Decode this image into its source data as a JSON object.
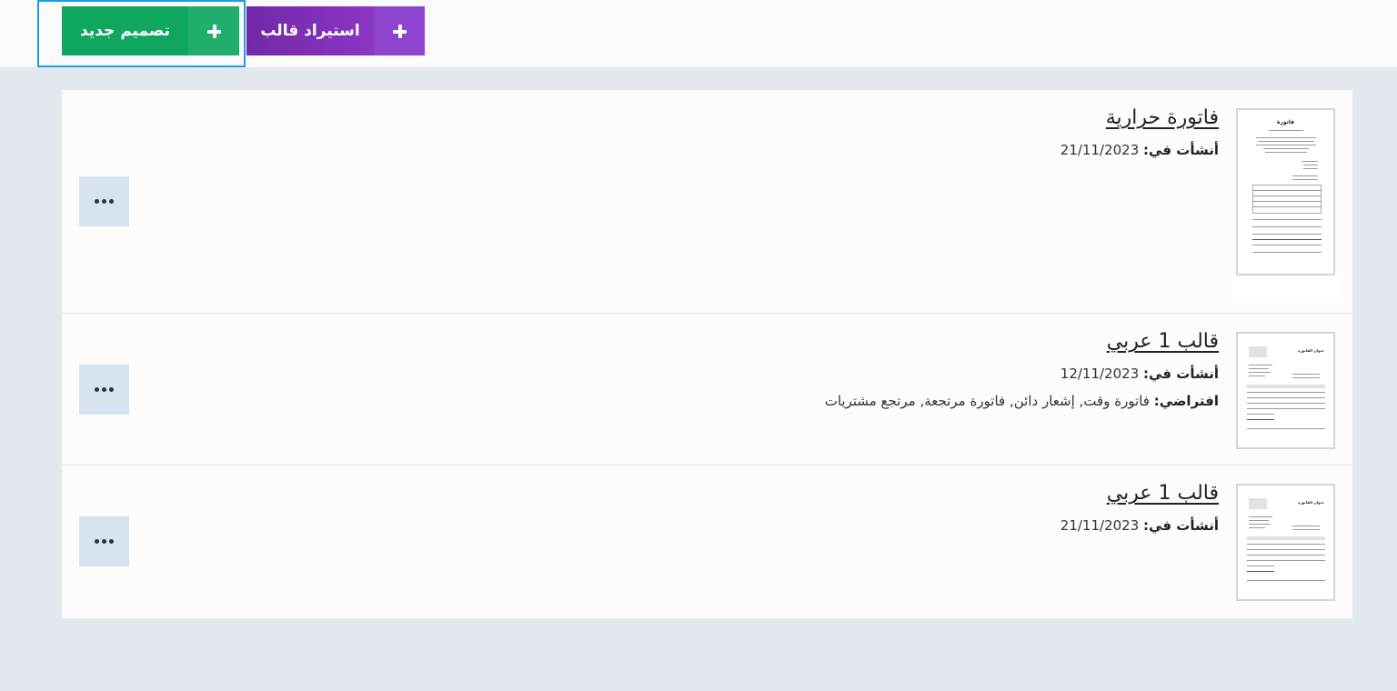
{
  "toolbar": {
    "design_label": "تصميم جديد",
    "import_label": "استيراد قالب"
  },
  "templates": [
    {
      "title": "فاتورة حرارية",
      "created_label": "أنشأت في:",
      "created_date": "21/11/2023",
      "default_label": "",
      "default_value": ""
    },
    {
      "title": "قالب 1 عربي",
      "created_label": "أنشأت في:",
      "created_date": "12/11/2023",
      "default_label": "افتراضي:",
      "default_value": "فاتورة وقت, إشعار دائن, فاتورة مرتجعة, مرتجع مشتريات"
    },
    {
      "title": "قالب 1 عربي",
      "created_label": "أنشأت في:",
      "created_date": "21/11/2023",
      "default_label": "",
      "default_value": ""
    }
  ],
  "thumbnails": {
    "thermal_heading": "فاتورة",
    "a4_heading": "عنوان الفاتورة"
  },
  "icons": {
    "add": "plus-icon",
    "more": "ellipsis-icon"
  },
  "colors": {
    "design_button": "#0fa660",
    "import_button": "#7e2fb8",
    "focus_ring": "#1aa0e0",
    "page_background": "#e3e8ee",
    "more_button": "#d7e3ef"
  }
}
